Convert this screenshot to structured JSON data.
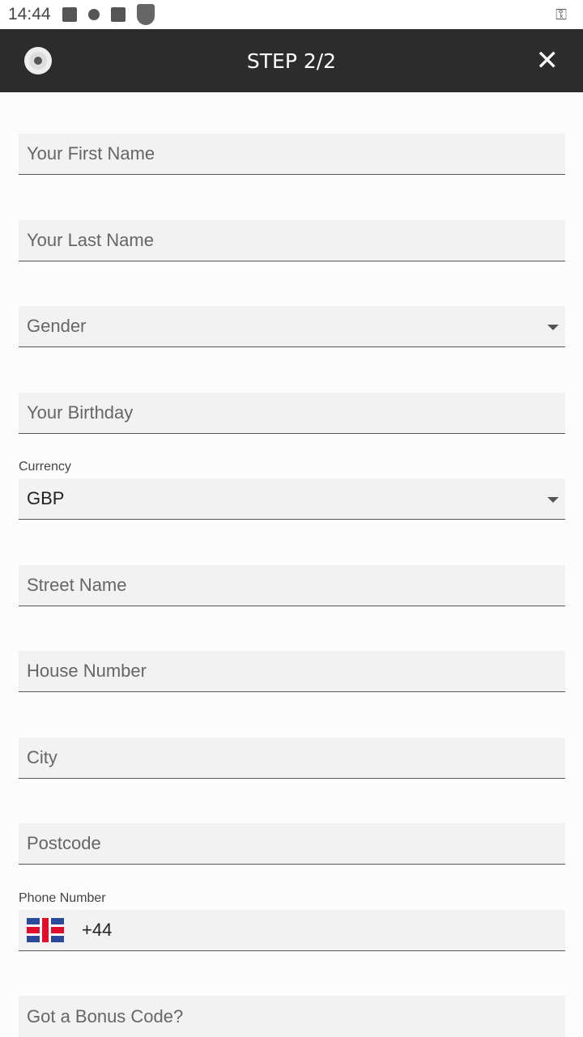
{
  "status_bar": {
    "time": "14:44"
  },
  "header": {
    "title": "STEP 2/2",
    "close_icon": "close-icon"
  },
  "form": {
    "first_name": {
      "placeholder": "Your First Name"
    },
    "last_name": {
      "placeholder": "Your Last Name"
    },
    "gender": {
      "placeholder": "Gender"
    },
    "birthday": {
      "placeholder": "Your Birthday"
    },
    "currency": {
      "label": "Currency",
      "value": "GBP"
    },
    "street": {
      "placeholder": "Street Name"
    },
    "house": {
      "placeholder": "House Number"
    },
    "city": {
      "placeholder": "City"
    },
    "postcode": {
      "placeholder": "Postcode"
    },
    "phone": {
      "label": "Phone Number",
      "prefix": "+44",
      "flag": "uk-flag"
    },
    "bonus": {
      "placeholder": "Got a Bonus Code?"
    }
  }
}
